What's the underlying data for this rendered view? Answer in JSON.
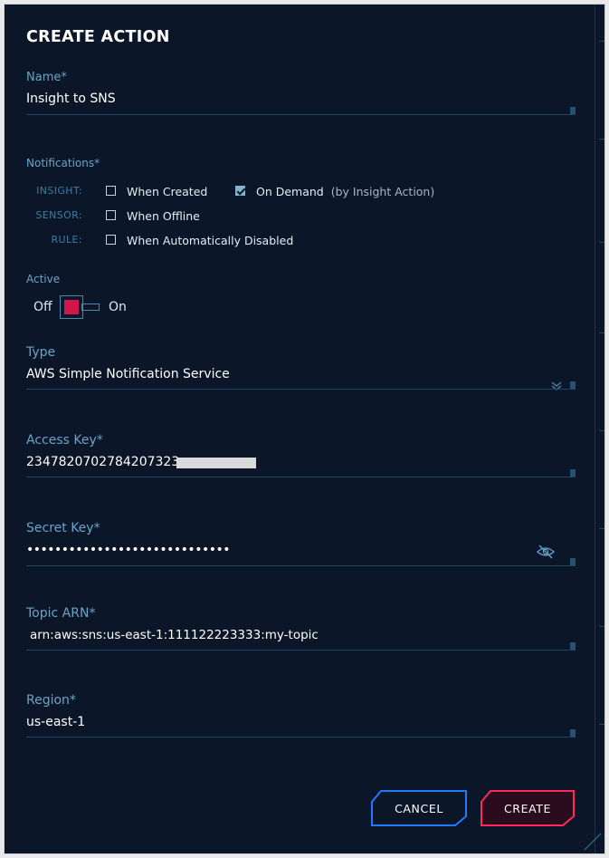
{
  "dialog": {
    "title": "CREATE ACTION"
  },
  "fields": {
    "name": {
      "label": "Name*",
      "value": "Insight to SNS"
    },
    "notifications": {
      "label": "Notifications*",
      "rows": [
        {
          "category": "INSIGHT:",
          "options": [
            {
              "label": "When Created",
              "checked": false
            },
            {
              "label": "On Demand",
              "hint": "(by Insight Action)",
              "checked": true
            }
          ]
        },
        {
          "category": "SENSOR:",
          "options": [
            {
              "label": "When Offline",
              "checked": false
            }
          ]
        },
        {
          "category": "RULE:",
          "options": [
            {
              "label": "When Automatically Disabled",
              "checked": false
            }
          ]
        }
      ]
    },
    "active": {
      "label": "Active",
      "off_label": "Off",
      "on_label": "On",
      "value": false
    },
    "type": {
      "label": "Type",
      "value": "AWS Simple Notification Service"
    },
    "access_key": {
      "label": "Access Key*",
      "value": "2347820702784207323"
    },
    "secret_key": {
      "label": "Secret Key*",
      "value": "•••••••••••••••••••••••••••••"
    },
    "topic_arn": {
      "label": "Topic ARN*",
      "value": "arn:aws:sns:us-east-1:111122223333:my-topic"
    },
    "region": {
      "label": "Region*",
      "value": "us-east-1"
    }
  },
  "buttons": {
    "cancel": "CANCEL",
    "create": "CREATE"
  },
  "colors": {
    "background": "#0b1628",
    "label": "#6aa4c8",
    "toggle_knob": "#d2154a",
    "cancel_border": "#1e7bff",
    "create_border": "#ff2a5a"
  },
  "icons": {
    "type_dropdown": "double-chevron-down-icon",
    "secret_visibility": "eye-slash-icon"
  }
}
